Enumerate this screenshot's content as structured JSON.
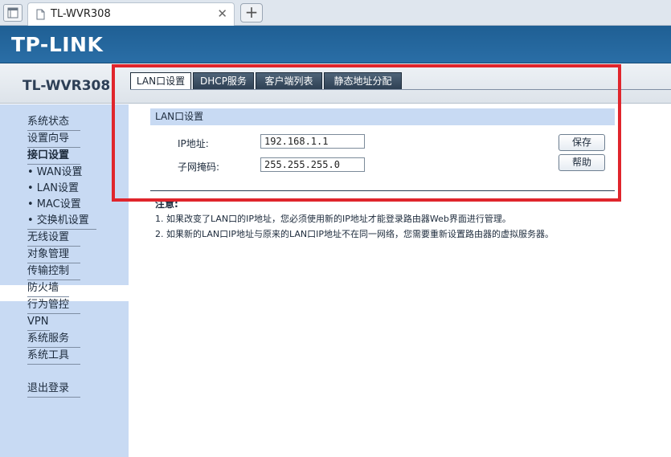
{
  "browser": {
    "tab_title": "TL-WVR308",
    "close_glyph": "✕",
    "newtab_glyph": "+"
  },
  "header": {
    "logo": "TP-LINK",
    "model": "TL-WVR308"
  },
  "sidebar": {
    "items": [
      {
        "label": "系统状态"
      },
      {
        "label": "设置向导"
      },
      {
        "label": "接口设置"
      },
      {
        "label": "• WAN设置"
      },
      {
        "label": "• LAN设置"
      },
      {
        "label": "• MAC设置"
      },
      {
        "label": "• 交换机设置"
      },
      {
        "label": "无线设置"
      },
      {
        "label": "对象管理"
      },
      {
        "label": "传输控制"
      },
      {
        "label": "防火墙"
      },
      {
        "label": "行为管控"
      },
      {
        "label": "VPN"
      },
      {
        "label": "系统服务"
      },
      {
        "label": "系统工具"
      },
      {
        "label": "退出登录"
      }
    ]
  },
  "tabs": [
    {
      "label": "LAN口设置"
    },
    {
      "label": "DHCP服务"
    },
    {
      "label": "客户端列表"
    },
    {
      "label": "静态地址分配"
    }
  ],
  "section": {
    "title": "LAN口设置",
    "ip_label": "IP地址:",
    "ip_value": "192.168.1.1",
    "mask_label": "子网掩码:",
    "mask_value": "255.255.255.0",
    "save_label": "保存",
    "help_label": "帮助"
  },
  "notes": {
    "title": "注意:",
    "line1": "1. 如果改变了LAN口的IP地址，您必须使用新的IP地址才能登录路由器Web界面进行管理。",
    "line2": "2. 如果新的LAN口IP地址与原来的LAN口IP地址不在同一网络，您需要重新设置路由器的虚拟服务器。"
  },
  "colors": {
    "highlight": "#e0252c",
    "header": "#2a6ea6",
    "sidebar": "#c8daf3"
  }
}
